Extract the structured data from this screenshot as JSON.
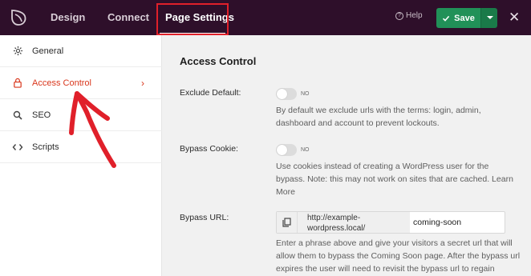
{
  "topbar": {
    "tabs": [
      "Design",
      "Connect",
      "Page Settings"
    ],
    "help_label": "Help",
    "save_label": "Save",
    "close_glyph": "✕"
  },
  "sidebar": {
    "items": [
      {
        "label": "General",
        "icon": "gear-icon"
      },
      {
        "label": "Access Control",
        "icon": "lock-icon"
      },
      {
        "label": "SEO",
        "icon": "search-icon"
      },
      {
        "label": "Scripts",
        "icon": "code-icon"
      }
    ],
    "active": "Access Control"
  },
  "main": {
    "title": "Access Control",
    "exclude_default": {
      "label": "Exclude Default:",
      "toggle_text": "NO",
      "help": "By default we exclude urls with the terms: login, admin, dashboard and account to prevent lockouts."
    },
    "bypass_cookie": {
      "label": "Bypass Cookie:",
      "toggle_text": "NO",
      "help": "Use cookies instead of creating a WordPress user for the bypass. Note: this may not work on sites that are cached. Learn More"
    },
    "bypass_url": {
      "label": "Bypass URL:",
      "prefix": "http://example-wordpress.local/",
      "value": "coming-soon",
      "help": "Enter a phrase above and give your visitors a secret url that will allow them to bypass the Coming Soon page. After the bypass url expires the user will need to revisit the bypass url to regain access."
    }
  },
  "colors": {
    "topbar": "#2e0f2a",
    "save": "#219158",
    "accent": "#d9361c",
    "annotation": "#e0202a"
  }
}
